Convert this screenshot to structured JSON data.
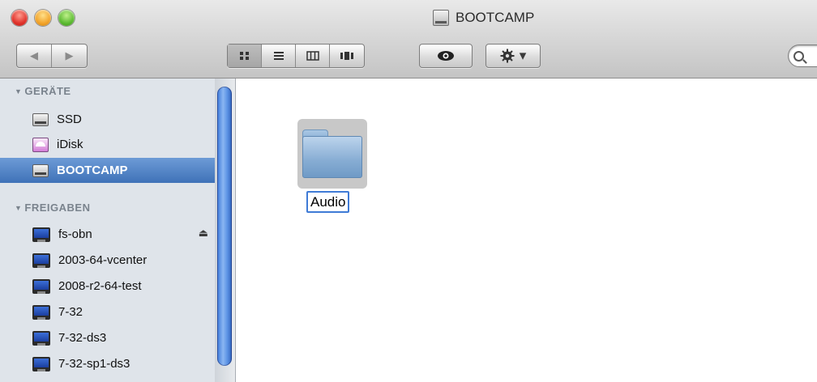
{
  "window": {
    "title": "BOOTCAMP"
  },
  "toolbar": {
    "back_icon": "◀",
    "forward_icon": "▶",
    "view_modes": [
      "icon-view",
      "list-view",
      "column-view",
      "coverflow-view"
    ],
    "active_view": "icon-view",
    "quicklook_icon": "eye",
    "action_icon": "gear",
    "action_dropdown_glyph": "▾",
    "search_placeholder": ""
  },
  "sidebar": {
    "devices_header": "GERÄTE",
    "devices": [
      {
        "label": "SSD",
        "icon": "hard-drive"
      },
      {
        "label": "iDisk",
        "icon": "idisk"
      },
      {
        "label": "BOOTCAMP",
        "icon": "hard-drive",
        "selected": true
      }
    ],
    "shared_header": "FREIGABEN",
    "shared": [
      {
        "label": "fs-obn",
        "icon": "network-pc",
        "eject": true
      },
      {
        "label": "2003-64-vcenter",
        "icon": "network-pc"
      },
      {
        "label": "2008-r2-64-test",
        "icon": "network-pc"
      },
      {
        "label": "7-32",
        "icon": "network-pc"
      },
      {
        "label": "7-32-ds3",
        "icon": "network-pc"
      },
      {
        "label": "7-32-sp1-ds3",
        "icon": "network-pc"
      }
    ],
    "eject_glyph": "⏏"
  },
  "content": {
    "items": [
      {
        "name": "Audio",
        "kind": "folder",
        "renaming": true
      }
    ]
  },
  "colors": {
    "selection": "#3f72b8",
    "sidebar_bg": "#dfe4ea",
    "rename_border": "#3f7bd6"
  }
}
